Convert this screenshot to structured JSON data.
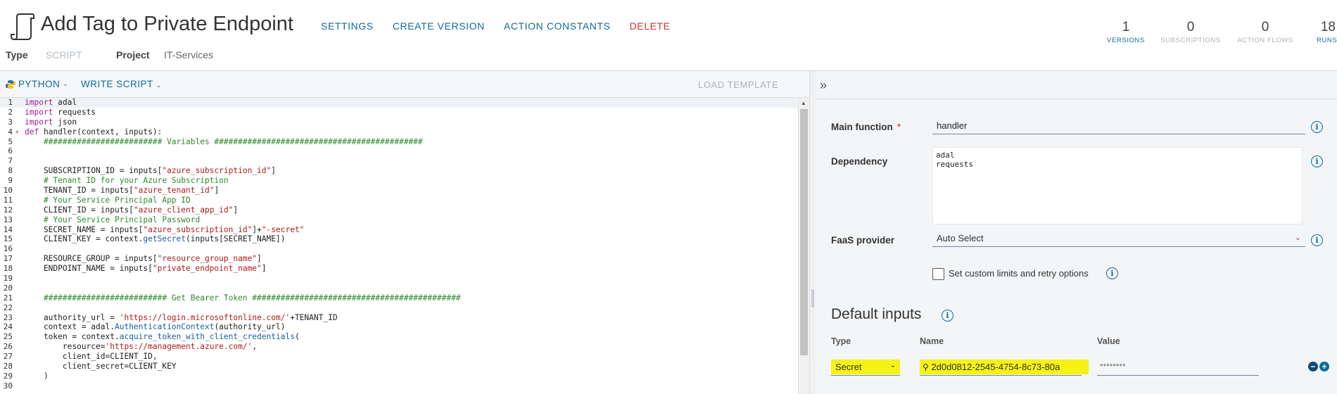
{
  "header": {
    "title": "Add Tag to Private Endpoint",
    "actions": {
      "settings": "SETTINGS",
      "create_version": "CREATE VERSION",
      "action_constants": "ACTION CONSTANTS",
      "delete": "DELETE"
    },
    "meta": {
      "type_label": "Type",
      "type_value": "SCRIPT",
      "project_label": "Project",
      "project_value": "IT-Services"
    },
    "stats": [
      {
        "value": "1",
        "label": "VERSIONS"
      },
      {
        "value": "0",
        "label": "SUBSCRIPTIONS"
      },
      {
        "value": "0",
        "label": "ACTION FLOWS"
      },
      {
        "value": "18",
        "label": "RUNS"
      }
    ]
  },
  "editor": {
    "language": "PYTHON",
    "write_script": "WRITE SCRIPT",
    "load_template": "LOAD TEMPLATE",
    "lines": [
      "import adal",
      "import requests",
      "import json",
      "def handler(context, inputs):",
      "    ######################### Variables ############################################",
      "",
      "",
      "    SUBSCRIPTION_ID = inputs[\"azure_subscription_id\"]",
      "    # Tenant ID for your Azure Subscription",
      "    TENANT_ID = inputs[\"azure_tenant_id\"]",
      "    # Your Service Principal App ID",
      "    CLIENT_ID = inputs[\"azure_client_app_id\"]",
      "    # Your Service Principal Password",
      "    SECRET_NAME = inputs[\"azure_subscription_id\"]+\"-secret\"",
      "    CLIENT_KEY = context.getSecret(inputs[SECRET_NAME])",
      "",
      "    RESOURCE_GROUP = inputs[\"resource_group_name\"]",
      "    ENDPOINT_NAME = inputs[\"private_endpoint_name\"]",
      "",
      "",
      "    ########################## Get Bearer Token ############################################",
      "",
      "    authority_url = 'https://login.microsoftonline.com/'+TENANT_ID",
      "    context = adal.AuthenticationContext(authority_url)",
      "    token = context.acquire_token_with_client_credentials(",
      "        resource='https://management.azure.com/',",
      "        client_id=CLIENT_ID,",
      "        client_secret=CLIENT_KEY",
      "    )",
      ""
    ]
  },
  "panel": {
    "main_function_label": "Main function",
    "required_mark": "*",
    "main_function_value": "handler",
    "dependency_label": "Dependency",
    "dependency_value": "adal\nrequests",
    "faas_label": "FaaS provider",
    "faas_value": "Auto Select",
    "custom_limits_label": "Set custom limits and retry options",
    "default_inputs_title": "Default inputs",
    "columns": {
      "type": "Type",
      "name": "Name",
      "value": "Value"
    },
    "input_row": {
      "type": "Secret",
      "name": "2d0d0812-2545-4754-8c73-80a",
      "value": "••••••••"
    }
  },
  "colors": {
    "accent": "#0f6b9c",
    "danger": "#d5312c",
    "highlight": "#f5f214"
  }
}
